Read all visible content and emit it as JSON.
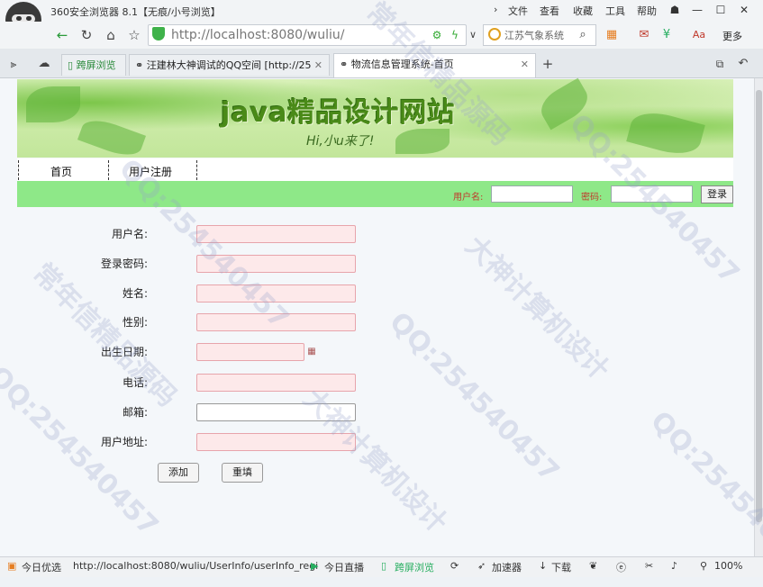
{
  "browser": {
    "title": "360安全浏览器 8.1【无痕/小号浏览】",
    "menus": [
      "文件",
      "查看",
      "收藏",
      "工具",
      "帮助"
    ],
    "more_label": "更多",
    "address_url": "http://localhost:8080/wuliu/",
    "search_placeholder": "江苏气象系统",
    "tab_quick_label": "跨屏浏览",
    "tabs": [
      {
        "label": "汪建林大神调试的QQ空间 [http://25"
      },
      {
        "label": "物流信息管理系统-首页",
        "active": true
      }
    ]
  },
  "site": {
    "banner_title": "java精品设计网站",
    "banner_subtitle": "Hi,小u来了!",
    "nav": [
      "首页",
      "用户注册"
    ],
    "login": {
      "username_label": "用户名:",
      "password_label": "密码:",
      "button": "登录"
    }
  },
  "form": {
    "fields": [
      {
        "label": "用户名:"
      },
      {
        "label": "登录密码:"
      },
      {
        "label": "姓名:"
      },
      {
        "label": "性别:"
      },
      {
        "label": "出生日期:"
      },
      {
        "label": "电话:"
      },
      {
        "label": "邮箱:"
      },
      {
        "label": "用户地址:"
      }
    ],
    "submit": "添加",
    "reset": "重填"
  },
  "status_bar": {
    "today_pick": "今日优选",
    "url": "http://localhost:8080/wuliu/UserInfo/userInfo_regi",
    "live": "今日直播",
    "cross_screen": "跨屏浏览",
    "accelerator": "加速器",
    "download": "下载",
    "zoom": "100%"
  },
  "watermark": [
    "常年信精品源码",
    "QQ:254540457",
    "大神计算机设计"
  ],
  "colors": {
    "login_bar": "#8ee888",
    "required_field": "#fde9ea",
    "label_red": "#c0392b"
  }
}
